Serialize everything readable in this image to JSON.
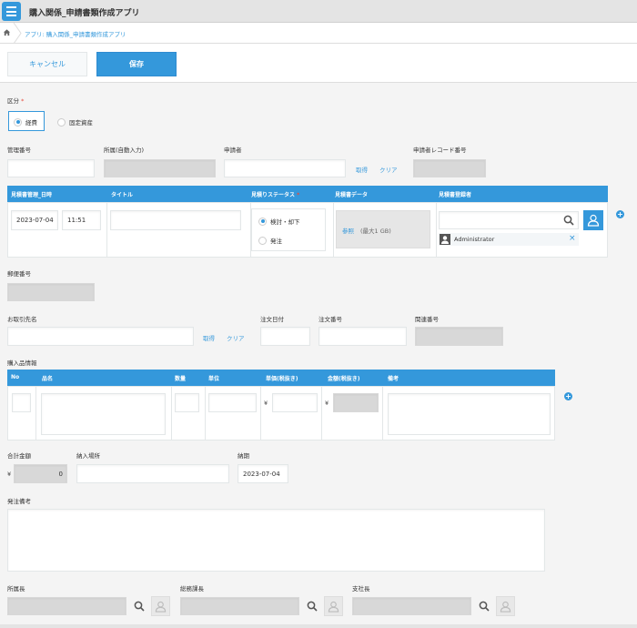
{
  "header": {
    "app_title": "購入関係_申請書類作成アプリ"
  },
  "breadcrumb": {
    "text": "アプリ: 購入関係_申請書類作成アプリ"
  },
  "toolbar": {
    "cancel_label": "キャンセル",
    "save_label": "保存"
  },
  "form": {
    "category": {
      "label": "区分",
      "required": "*",
      "options": [
        "経費",
        "固定資産"
      ],
      "selected": "経費"
    },
    "mgmt_no": {
      "label": "管理番号",
      "value": ""
    },
    "dept": {
      "label": "所属(自動入力)",
      "value": ""
    },
    "applicant": {
      "label": "申請者",
      "value": "",
      "fetch": "取得",
      "clear": "クリア"
    },
    "applicant_record_no": {
      "label": "申請者レコード番号",
      "value": ""
    },
    "quote_table": {
      "headers": [
        "見積書管理_日時",
        "タイトル",
        "見積りステータス",
        "見積書データ",
        "見積書登録者"
      ],
      "required": "*",
      "date": "2023-07-04",
      "time": "11:51",
      "title": "",
      "status_options": [
        "検討・却下",
        "発注"
      ],
      "status_selected": "検討・却下",
      "file_browse": "参照",
      "file_max": "(最大1 GB)",
      "registrant": "Administrator",
      "remove": "×"
    },
    "postal": {
      "label": "郵便番号",
      "value": ""
    },
    "supplier": {
      "label": "お取引先名",
      "value": "",
      "fetch": "取得",
      "clear": "クリア"
    },
    "order_date": {
      "label": "注文日付",
      "value": ""
    },
    "order_no": {
      "label": "注文番号",
      "value": ""
    },
    "related_no": {
      "label": "関連番号",
      "value": ""
    },
    "items_section_label": "購入品情報",
    "items_table": {
      "headers": [
        "No",
        "品名",
        "数量",
        "単位",
        "単価(税抜き)",
        "金額(税抜き)",
        "備考"
      ],
      "yen": "¥"
    },
    "total": {
      "label": "合計金額",
      "yen": "¥",
      "value": "0"
    },
    "delivery_place": {
      "label": "納入場所",
      "value": ""
    },
    "delivery_date": {
      "label": "納期",
      "value": "2023-07-04"
    },
    "order_notes": {
      "label": "発注備考",
      "value": ""
    },
    "approvers": [
      {
        "label": "所属長"
      },
      {
        "label": "総務課長"
      },
      {
        "label": "支社長"
      }
    ]
  },
  "colors": {
    "accent": "#3498db",
    "required": "#e74c3c"
  }
}
